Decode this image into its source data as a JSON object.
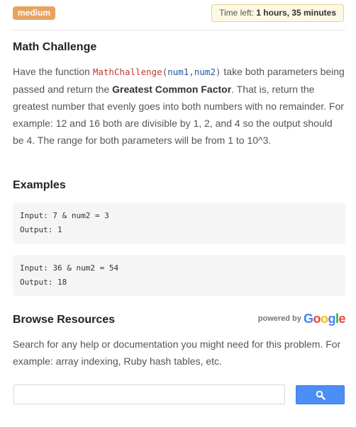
{
  "header": {
    "difficulty_badge": "medium",
    "timer_prefix": "Time left: ",
    "timer_value": "1 hours, 35 minutes"
  },
  "problem": {
    "title": "Math Challenge",
    "desc_intro": "Have the function ",
    "function_name": "MathChallenge",
    "paren_open": "(",
    "arg1": "num1",
    "comma": ",",
    "arg2": "num2",
    "paren_close": ")",
    "desc_mid": " take both parameters being passed and return the ",
    "desc_bold": "Greatest Common Factor",
    "desc_end": ". That is, return the greatest number that evenly goes into both numbers with no remainder. For example: 12 and 16 both are divisible by 1, 2, and 4 so the output should be 4. The range for both parameters will be from 1 to 10^3."
  },
  "examples": {
    "title": "Examples",
    "items": [
      {
        "input": "Input: 7 & num2 = 3",
        "output": "Output: 1"
      },
      {
        "input": "Input: 36 & num2 = 54",
        "output": "Output: 18"
      }
    ]
  },
  "resources": {
    "title": "Browse Resources",
    "powered_by": "powered by",
    "google_letters": [
      "G",
      "o",
      "o",
      "g",
      "l",
      "e"
    ],
    "google_colors": [
      "#4285f4",
      "#ea4335",
      "#fbbc05",
      "#4285f4",
      "#34a853",
      "#ea4335"
    ],
    "description": "Search for any help or documentation you might need for this problem. For example: array indexing, Ruby hash tables, etc.",
    "search_placeholder": "",
    "search_icon": "magnifier-icon"
  },
  "colors": {
    "badge": "#e7a460",
    "timer_bg": "#fdf8e3",
    "search_button": "#4c8ef7",
    "function_name": "#c0392b",
    "arguments": "#2457a5"
  }
}
